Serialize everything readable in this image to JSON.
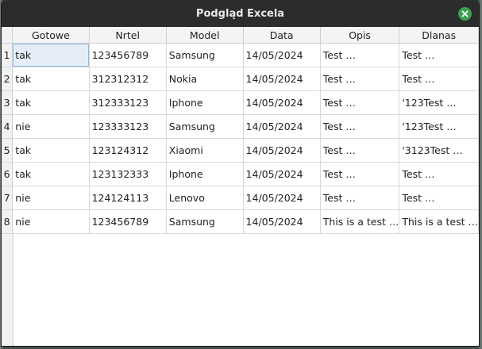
{
  "window": {
    "title": "Podgląd Excela",
    "close_icon": "close-icon"
  },
  "colors": {
    "titlebar_bg": "#2c2c2c",
    "close_button": "#3aa150",
    "selected_cell": "#e5eef8"
  },
  "table": {
    "columns": [
      "Gotowe",
      "Nrtel",
      "Model",
      "Data",
      "Opis",
      "Dlanas"
    ],
    "selected_cell": {
      "row": 1,
      "column": "Gotowe"
    },
    "rows": [
      {
        "num": "1",
        "cells": [
          "tak",
          "123456789",
          "Samsung",
          "14/05/2024",
          "Test …",
          "Test …"
        ]
      },
      {
        "num": "2",
        "cells": [
          "tak",
          "312312312",
          "Nokia",
          "14/05/2024",
          "Test …",
          "Test …"
        ]
      },
      {
        "num": "3",
        "cells": [
          "tak",
          "312333123",
          "Iphone",
          "14/05/2024",
          "Test …",
          "'123Test …"
        ]
      },
      {
        "num": "4",
        "cells": [
          "nie",
          "123333123",
          "Samsung",
          "14/05/2024",
          "Test …",
          "'123Test …"
        ]
      },
      {
        "num": "5",
        "cells": [
          "tak",
          "123124312",
          "Xiaomi",
          "14/05/2024",
          "Test …",
          "'3123Test …"
        ]
      },
      {
        "num": "6",
        "cells": [
          "tak",
          "123132333",
          "Iphone",
          "14/05/2024",
          "Test …",
          "Test …"
        ]
      },
      {
        "num": "7",
        "cells": [
          "nie",
          "124124113",
          "Lenovo",
          "14/05/2024",
          "Test …",
          "Test …"
        ]
      },
      {
        "num": "8",
        "cells": [
          "nie",
          "123456789",
          "Samsung",
          "14/05/2024",
          "This is a test …",
          "This is a test …"
        ]
      }
    ]
  }
}
